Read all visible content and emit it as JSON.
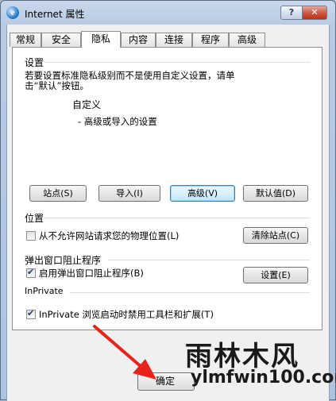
{
  "window": {
    "title": "Internet 属性",
    "help_label": "?",
    "close_label": "✕"
  },
  "tabs": [
    {
      "label": "常规"
    },
    {
      "label": "安全"
    },
    {
      "label": "隐私"
    },
    {
      "label": "内容"
    },
    {
      "label": "连接"
    },
    {
      "label": "程序"
    },
    {
      "label": "高级"
    }
  ],
  "settings": {
    "heading": "设置",
    "description": "若要设置标准隐私级别而不是使用自定义设置，请单击“默认”按钮。",
    "level": "自定义",
    "detail": "- 高级或导入的设置",
    "buttons": {
      "sites": "站点(S)",
      "import": "导入(I)",
      "advanced": "高级(V)",
      "default": "默认值(D)"
    }
  },
  "location": {
    "heading": "位置",
    "checkbox_label": "从不允许网站请求您的物理位置(L)",
    "checkbox_checked": false,
    "clear_button": "清除站点(C)"
  },
  "popup": {
    "heading": "弹出窗口阻止程序",
    "checkbox_label": "启用弹出窗口阻止程序(B)",
    "checkbox_checked": true,
    "settings_button": "设置(E)"
  },
  "inprivate": {
    "heading": "InPrivate",
    "checkbox_label": "InPrivate 浏览启动时禁用工具栏和扩展(T)",
    "checkbox_checked": true
  },
  "footer": {
    "ok_label": "确定"
  },
  "watermark": {
    "brand": "雨林木风",
    "url": "ylmfwin100.com"
  },
  "colors": {
    "arrow": "#e8231c",
    "focus_border": "#3c7fb1"
  }
}
